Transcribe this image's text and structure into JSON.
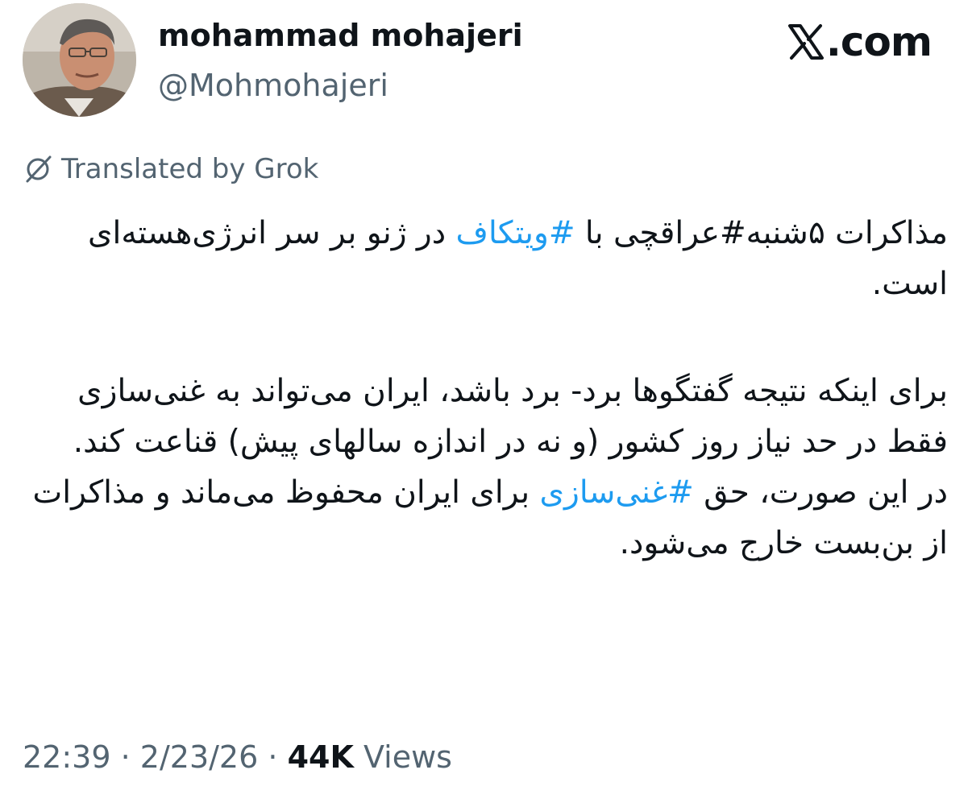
{
  "author": {
    "display_name": "mohammad mohajeri",
    "handle": "@Mohmohajeri"
  },
  "brand": {
    "site_label": ".com",
    "logo_icon": "x-logo-icon"
  },
  "translation": {
    "icon": "translate-slash-icon",
    "label": "Translated by Grok"
  },
  "tweet": {
    "p1_a": "مذاکرات ۵شنبه#عراقچی با ",
    "p1_hashtag": "#ویتکاف",
    "p1_b": " در ژنو بر سر انرژی‌هسته‌ای است.",
    "p2": "برای اینکه نتیجه گفتگوها برد- برد باشد، ایران می‌تواند به غنی‌سازی فقط در حد نیاز روز کشور (و نه در اندازه سالهای پیش) قناعت کند.",
    "p3_a": "در این صورت، حق ",
    "p3_hashtag": "#غنی‌سازی",
    "p3_b": " برای ایران محفوظ می‌ماند و مذاکرات از بن‌بست خارج می‌شود."
  },
  "meta": {
    "time": "22:39",
    "separator": "·",
    "date": "2/23/26",
    "views_count": "44K",
    "views_label": "Views"
  },
  "colors": {
    "text": "#0f1419",
    "secondary": "#536471",
    "link": "#1d9bf0"
  }
}
